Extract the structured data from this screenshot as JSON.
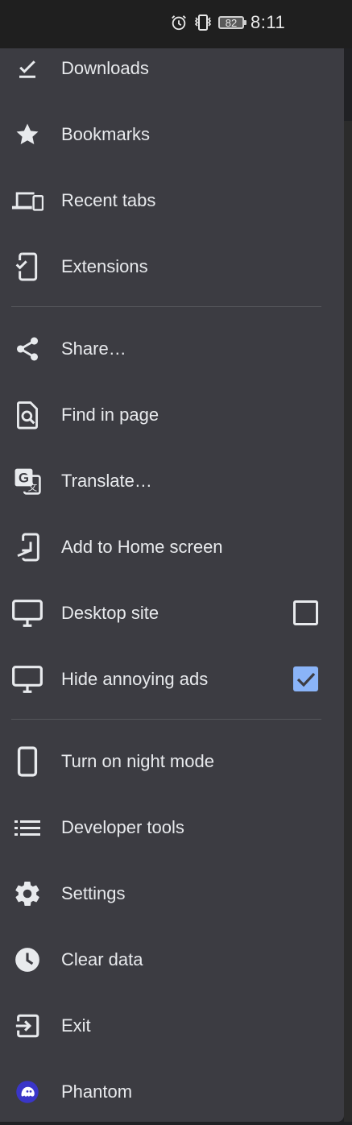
{
  "status": {
    "battery": "82",
    "time": "8:11"
  },
  "menu": {
    "downloads": "Downloads",
    "bookmarks": "Bookmarks",
    "recent_tabs": "Recent tabs",
    "extensions": "Extensions",
    "share": "Share…",
    "find_in_page": "Find in page",
    "translate": "Translate…",
    "add_to_home": "Add to Home screen",
    "desktop_site": "Desktop site",
    "hide_ads": "Hide annoying ads",
    "night_mode": "Turn on night mode",
    "developer_tools": "Developer tools",
    "settings": "Settings",
    "clear_data": "Clear data",
    "exit": "Exit",
    "phantom": "Phantom"
  },
  "checkboxes": {
    "desktop_site_checked": false,
    "hide_ads_checked": true
  },
  "colors": {
    "menu_bg": "#3c3c42",
    "text": "#e8eaed",
    "accent": "#8ab4f8",
    "phantom": "#ab9ff2"
  },
  "icons": {
    "downloads": "download-done-icon",
    "bookmarks": "star-icon",
    "recent_tabs": "devices-icon",
    "extensions": "phone-check-icon",
    "share": "share-icon",
    "find_in_page": "find-in-page-icon",
    "translate": "translate-icon",
    "add_to_home": "add-to-home-icon",
    "desktop_site": "monitor-icon",
    "hide_ads": "monitor-icon",
    "night_mode": "phone-icon",
    "developer_tools": "list-icon",
    "settings": "gear-icon",
    "clear_data": "clock-icon",
    "exit": "exit-icon",
    "phantom": "phantom-ghost-icon"
  }
}
